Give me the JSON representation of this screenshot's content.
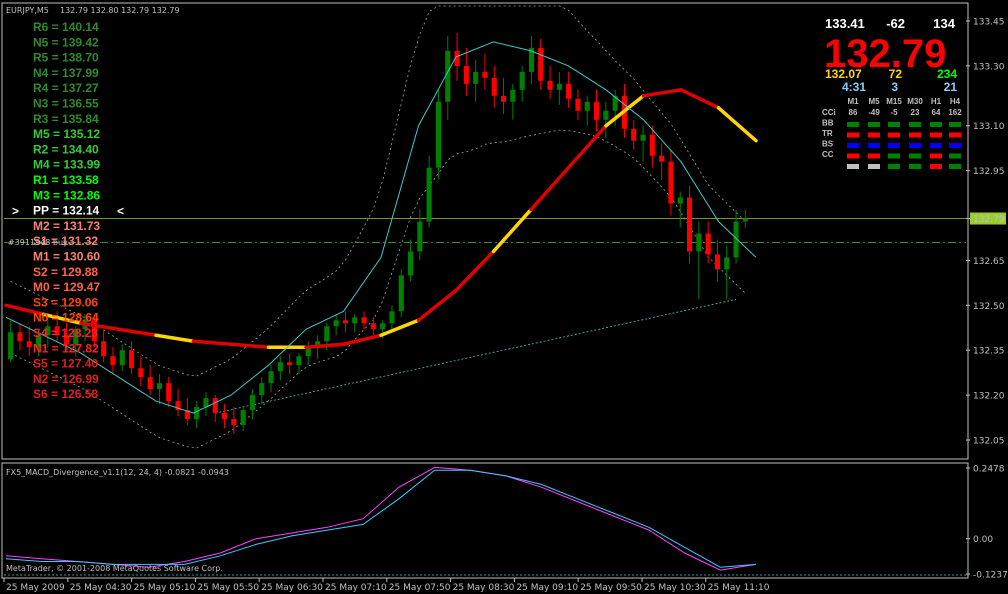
{
  "window": {
    "symbol_header": "EURJPY,M5",
    "ohlc_header": "132.79 132.80 132.79 132.79",
    "order_label": "#3911948 buy",
    "copyright": "MetaTrader, © 2001-2008 MetaQuotes Software Corp.",
    "pivot_marker_left": ">",
    "pivot_marker_right": "<"
  },
  "colors": {
    "background": "#000000",
    "bull_candle": "#008000",
    "bear_candle": "#ff0000",
    "ma_red": "#e00000",
    "ma_yellow": "#ffd700",
    "ma_cyan": "#40c8c8",
    "macd_main": "#ff40ff",
    "macd_signal": "#40c8ff",
    "grid_line": "#c0c0c0"
  },
  "pivots": [
    {
      "label": "R6 = 140.14",
      "color": "#2e8b2e"
    },
    {
      "label": "N5 = 139.42",
      "color": "#2e8b2e"
    },
    {
      "label": "R5 = 138.70",
      "color": "#2e8b2e"
    },
    {
      "label": "N4 = 137.99",
      "color": "#2e8b2e"
    },
    {
      "label": "R4 = 137.27",
      "color": "#2e8b2e"
    },
    {
      "label": "N3 = 136.55",
      "color": "#2e8b2e"
    },
    {
      "label": "R3 = 135.84",
      "color": "#2e8b2e"
    },
    {
      "label": "M5 = 135.12",
      "color": "#32cd32"
    },
    {
      "label": "R2 = 134.40",
      "color": "#32cd32"
    },
    {
      "label": "M4 = 133.99",
      "color": "#32cd32"
    },
    {
      "label": "R1 = 133.58",
      "color": "#00ff00"
    },
    {
      "label": "M3 = 132.86",
      "color": "#00ff00"
    },
    {
      "label": "PP = 132.14",
      "color": "#ffffff"
    },
    {
      "label": "M2 = 131.73",
      "color": "#fa8072"
    },
    {
      "label": "S1 = 131.32",
      "color": "#fa8072"
    },
    {
      "label": "M1 = 130.60",
      "color": "#fa8072"
    },
    {
      "label": "S2 = 129.88",
      "color": "#ff6347"
    },
    {
      "label": "M0 = 129.47",
      "color": "#ff6347"
    },
    {
      "label": "S3 = 129.06",
      "color": "#ff4500"
    },
    {
      "label": "N0 = 128.64",
      "color": "#ff4500"
    },
    {
      "label": "S4 = 128.23",
      "color": "#ff2020"
    },
    {
      "label": "N1 = 127.82",
      "color": "#ff2020"
    },
    {
      "label": "S5 = 127.40",
      "color": "#dc2020"
    },
    {
      "label": "N2 = 126.99",
      "color": "#dc2020"
    },
    {
      "label": "S6 = 126.58",
      "color": "#dc2020"
    }
  ],
  "info_panel": {
    "high": "133.41",
    "spread": "-62",
    "range": "134",
    "price": "132.79",
    "low": "132.07",
    "pts1": "72",
    "pts2": "234",
    "timer": "4:31",
    "v1": "3",
    "v2": "21",
    "timeframes": [
      "M1",
      "M5",
      "M15",
      "M30",
      "H1",
      "H4"
    ],
    "row_labels": [
      "CCi",
      "BB",
      "TR",
      "BS",
      "CC"
    ],
    "cci_values": [
      "86",
      "-49",
      "-5",
      "23",
      "64",
      "162"
    ],
    "signal_rows": [
      [
        "#008000",
        "#008000",
        "#008000",
        "#008000",
        "#008000",
        "#008000"
      ],
      [
        "#ff0000",
        "#ff0000",
        "#ff0000",
        "#ff0000",
        "#ff0000",
        "#ff0000"
      ],
      [
        "#0000ff",
        "#0000ff",
        "#0000ff",
        "#0000ff",
        "#0000ff",
        "#0000ff"
      ],
      [
        "#ff0000",
        "#ff0000",
        "#008000",
        "#008000",
        "#ff0000",
        "#008000"
      ],
      [
        "#c0c0c0",
        "#c0c0c0",
        "#008000",
        "#008000",
        "#ff0000",
        "#008000"
      ]
    ]
  },
  "chart_data": [
    {
      "type": "candlestick",
      "title": "EURJPY,M5",
      "ylim": [
        132.0,
        133.5
      ],
      "yticks": [
        "133.45",
        "133.30",
        "133.10",
        "132.95",
        "132.79",
        "132.65",
        "132.50",
        "132.35",
        "132.20",
        "132.05"
      ],
      "price_line": 132.79,
      "order_line": 132.71,
      "xticks": [
        "25 May 2009",
        "25 May 04:30",
        "25 May 05:10",
        "25 May 05:50",
        "25 May 06:30",
        "25 May 07:10",
        "25 May 07:50",
        "25 May 08:30",
        "25 May 09:10",
        "25 May 09:50",
        "25 May 10:30",
        "25 May 11:10"
      ],
      "candles": [
        [
          132.32,
          132.45,
          132.31,
          132.41
        ],
        [
          132.41,
          132.44,
          132.35,
          132.38
        ],
        [
          132.38,
          132.43,
          132.33,
          132.36
        ],
        [
          132.36,
          132.42,
          132.33,
          132.4
        ],
        [
          132.4,
          132.46,
          132.36,
          132.43
        ],
        [
          132.43,
          132.48,
          132.38,
          132.4
        ],
        [
          132.4,
          132.44,
          132.35,
          132.37
        ],
        [
          132.37,
          132.43,
          132.33,
          132.42
        ],
        [
          132.42,
          132.47,
          132.38,
          132.45
        ],
        [
          132.45,
          132.47,
          132.36,
          132.38
        ],
        [
          132.38,
          132.42,
          132.31,
          132.33
        ],
        [
          132.33,
          132.36,
          132.27,
          132.3
        ],
        [
          132.3,
          132.37,
          132.28,
          132.35
        ],
        [
          132.35,
          132.38,
          132.27,
          132.29
        ],
        [
          132.29,
          132.33,
          132.23,
          132.26
        ],
        [
          132.26,
          132.3,
          132.2,
          132.22
        ],
        [
          132.22,
          132.27,
          132.17,
          132.24
        ],
        [
          132.24,
          132.26,
          132.16,
          132.18
        ],
        [
          132.18,
          132.22,
          132.13,
          132.15
        ],
        [
          132.15,
          132.19,
          132.1,
          132.12
        ],
        [
          132.12,
          132.18,
          132.09,
          132.16
        ],
        [
          132.16,
          132.21,
          132.13,
          132.19
        ],
        [
          132.19,
          132.2,
          132.11,
          132.14
        ],
        [
          132.14,
          132.17,
          132.09,
          132.12
        ],
        [
          132.12,
          132.16,
          132.07,
          132.1
        ],
        [
          132.1,
          132.16,
          132.08,
          132.15
        ],
        [
          132.15,
          132.22,
          132.12,
          132.2
        ],
        [
          132.2,
          132.26,
          132.17,
          132.24
        ],
        [
          132.24,
          132.3,
          132.21,
          132.28
        ],
        [
          132.28,
          132.33,
          132.25,
          132.31
        ],
        [
          132.31,
          132.34,
          132.27,
          132.3
        ],
        [
          132.3,
          132.34,
          132.27,
          132.33
        ],
        [
          132.33,
          132.38,
          132.3,
          132.36
        ],
        [
          132.36,
          132.4,
          132.32,
          132.38
        ],
        [
          132.38,
          132.44,
          132.35,
          132.43
        ],
        [
          132.43,
          132.47,
          132.4,
          132.45
        ],
        [
          132.45,
          132.48,
          132.41,
          132.44
        ],
        [
          132.44,
          132.47,
          132.41,
          132.46
        ],
        [
          132.46,
          132.48,
          132.42,
          132.44
        ],
        [
          132.44,
          132.46,
          132.4,
          132.42
        ],
        [
          132.42,
          132.45,
          132.39,
          132.44
        ],
        [
          132.44,
          132.5,
          132.42,
          132.48
        ],
        [
          132.48,
          132.62,
          132.46,
          132.6
        ],
        [
          132.6,
          132.72,
          132.58,
          132.68
        ],
        [
          132.68,
          132.82,
          132.65,
          132.78
        ],
        [
          132.78,
          133.0,
          132.76,
          132.96
        ],
        [
          132.96,
          133.22,
          132.92,
          133.18
        ],
        [
          133.18,
          133.4,
          133.12,
          133.35
        ],
        [
          133.35,
          133.41,
          133.25,
          133.3
        ],
        [
          133.3,
          133.36,
          133.2,
          133.24
        ],
        [
          133.24,
          133.32,
          133.18,
          133.28
        ],
        [
          133.28,
          133.34,
          133.22,
          133.26
        ],
        [
          133.26,
          133.3,
          133.16,
          133.2
        ],
        [
          133.2,
          133.26,
          133.14,
          133.18
        ],
        [
          133.18,
          133.24,
          133.12,
          133.22
        ],
        [
          133.22,
          133.3,
          133.18,
          133.28
        ],
        [
          133.28,
          133.4,
          133.24,
          133.36
        ],
        [
          133.36,
          133.39,
          133.22,
          133.25
        ],
        [
          133.25,
          133.3,
          133.19,
          133.22
        ],
        [
          133.22,
          133.28,
          133.17,
          133.24
        ],
        [
          133.24,
          133.28,
          133.16,
          133.19
        ],
        [
          133.19,
          133.22,
          133.12,
          133.15
        ],
        [
          133.15,
          133.2,
          133.1,
          133.18
        ],
        [
          133.18,
          133.22,
          133.08,
          133.12
        ],
        [
          133.12,
          133.18,
          133.06,
          133.15
        ],
        [
          133.15,
          133.22,
          133.1,
          133.2
        ],
        [
          133.2,
          133.24,
          133.06,
          133.09
        ],
        [
          133.09,
          133.12,
          133.02,
          133.05
        ],
        [
          133.05,
          133.1,
          132.98,
          133.07
        ],
        [
          133.07,
          133.1,
          132.96,
          133.0
        ],
        [
          133.0,
          133.04,
          132.92,
          132.98
        ],
        [
          132.98,
          133.02,
          132.8,
          132.84
        ],
        [
          132.84,
          132.88,
          132.76,
          132.86
        ],
        [
          132.86,
          132.9,
          132.64,
          132.68
        ],
        [
          132.68,
          132.78,
          132.52,
          132.74
        ],
        [
          132.74,
          132.78,
          132.64,
          132.67
        ],
        [
          132.67,
          132.72,
          132.58,
          132.62
        ],
        [
          132.62,
          132.7,
          132.52,
          132.66
        ],
        [
          132.66,
          132.82,
          132.64,
          132.78
        ],
        [
          132.78,
          132.82,
          132.76,
          132.79
        ]
      ],
      "ma_slow": [
        132.5,
        132.47,
        132.44,
        132.42,
        132.4,
        132.38,
        132.37,
        132.36,
        132.36,
        132.37,
        132.4,
        132.45,
        132.55,
        132.68,
        132.82,
        132.96,
        133.1,
        133.2,
        133.22,
        133.16,
        133.05
      ],
      "ma_fast": [
        132.46,
        132.4,
        132.34,
        132.26,
        132.18,
        132.14,
        132.2,
        132.3,
        132.42,
        132.48,
        132.66,
        133.1,
        133.33,
        133.38,
        133.35,
        133.3,
        133.22,
        133.12,
        132.98,
        132.78,
        132.66
      ]
    },
    {
      "type": "line",
      "title": "FX5_MACD_Divergence_v1.1(12, 24, 4) -0.0821 -0.0943",
      "ylim": [
        -0.1237,
        0.2478
      ],
      "yticks": [
        "0.2478",
        "0.00",
        "-0.1237"
      ],
      "series": [
        {
          "values": [
            -0.06,
            -0.07,
            -0.08,
            -0.09,
            -0.1,
            -0.08,
            -0.05,
            0.0,
            0.02,
            0.04,
            0.07,
            0.18,
            0.25,
            0.24,
            0.22,
            0.18,
            0.13,
            0.08,
            0.03,
            -0.05,
            -0.11,
            -0.09
          ]
        },
        {
          "values": [
            -0.07,
            -0.08,
            -0.08,
            -0.09,
            -0.09,
            -0.09,
            -0.06,
            -0.02,
            0.01,
            0.03,
            0.05,
            0.14,
            0.24,
            0.24,
            0.22,
            0.19,
            0.14,
            0.09,
            0.04,
            -0.03,
            -0.1,
            -0.09
          ]
        }
      ]
    }
  ]
}
